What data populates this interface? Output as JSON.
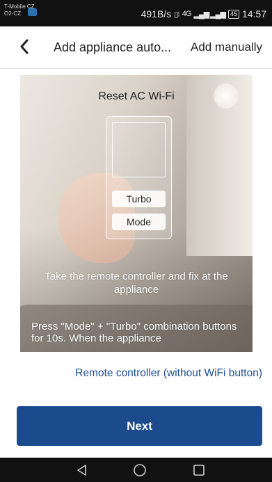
{
  "status_bar": {
    "carrier_line1": "T-Mobile CZ",
    "carrier_line2": "O2-CZ",
    "speed": "491B/s",
    "network": "4G",
    "battery": "45",
    "time": "14:57"
  },
  "header": {
    "back_icon": "chevron-left-icon",
    "title": "Add appliance auto...",
    "add_manually": "Add manually"
  },
  "illustration": {
    "title": "Reset AC Wi-Fi",
    "turbo_label": "Turbo",
    "mode_label": "Mode",
    "instruction_1": "Take the remote controller and fix at the appliance",
    "instruction_2": "Press \"Mode\" + \"Turbo\" combination buttons for 10s. When the appliance"
  },
  "remote_link": "Remote controller (without WiFi button)",
  "next_button": "Next",
  "nav_bar": {
    "back": "triangle-back-icon",
    "home": "circle-home-icon",
    "recents": "square-recents-icon"
  },
  "colors": {
    "accent": "#1b4b8c",
    "link": "#1f4e92"
  }
}
